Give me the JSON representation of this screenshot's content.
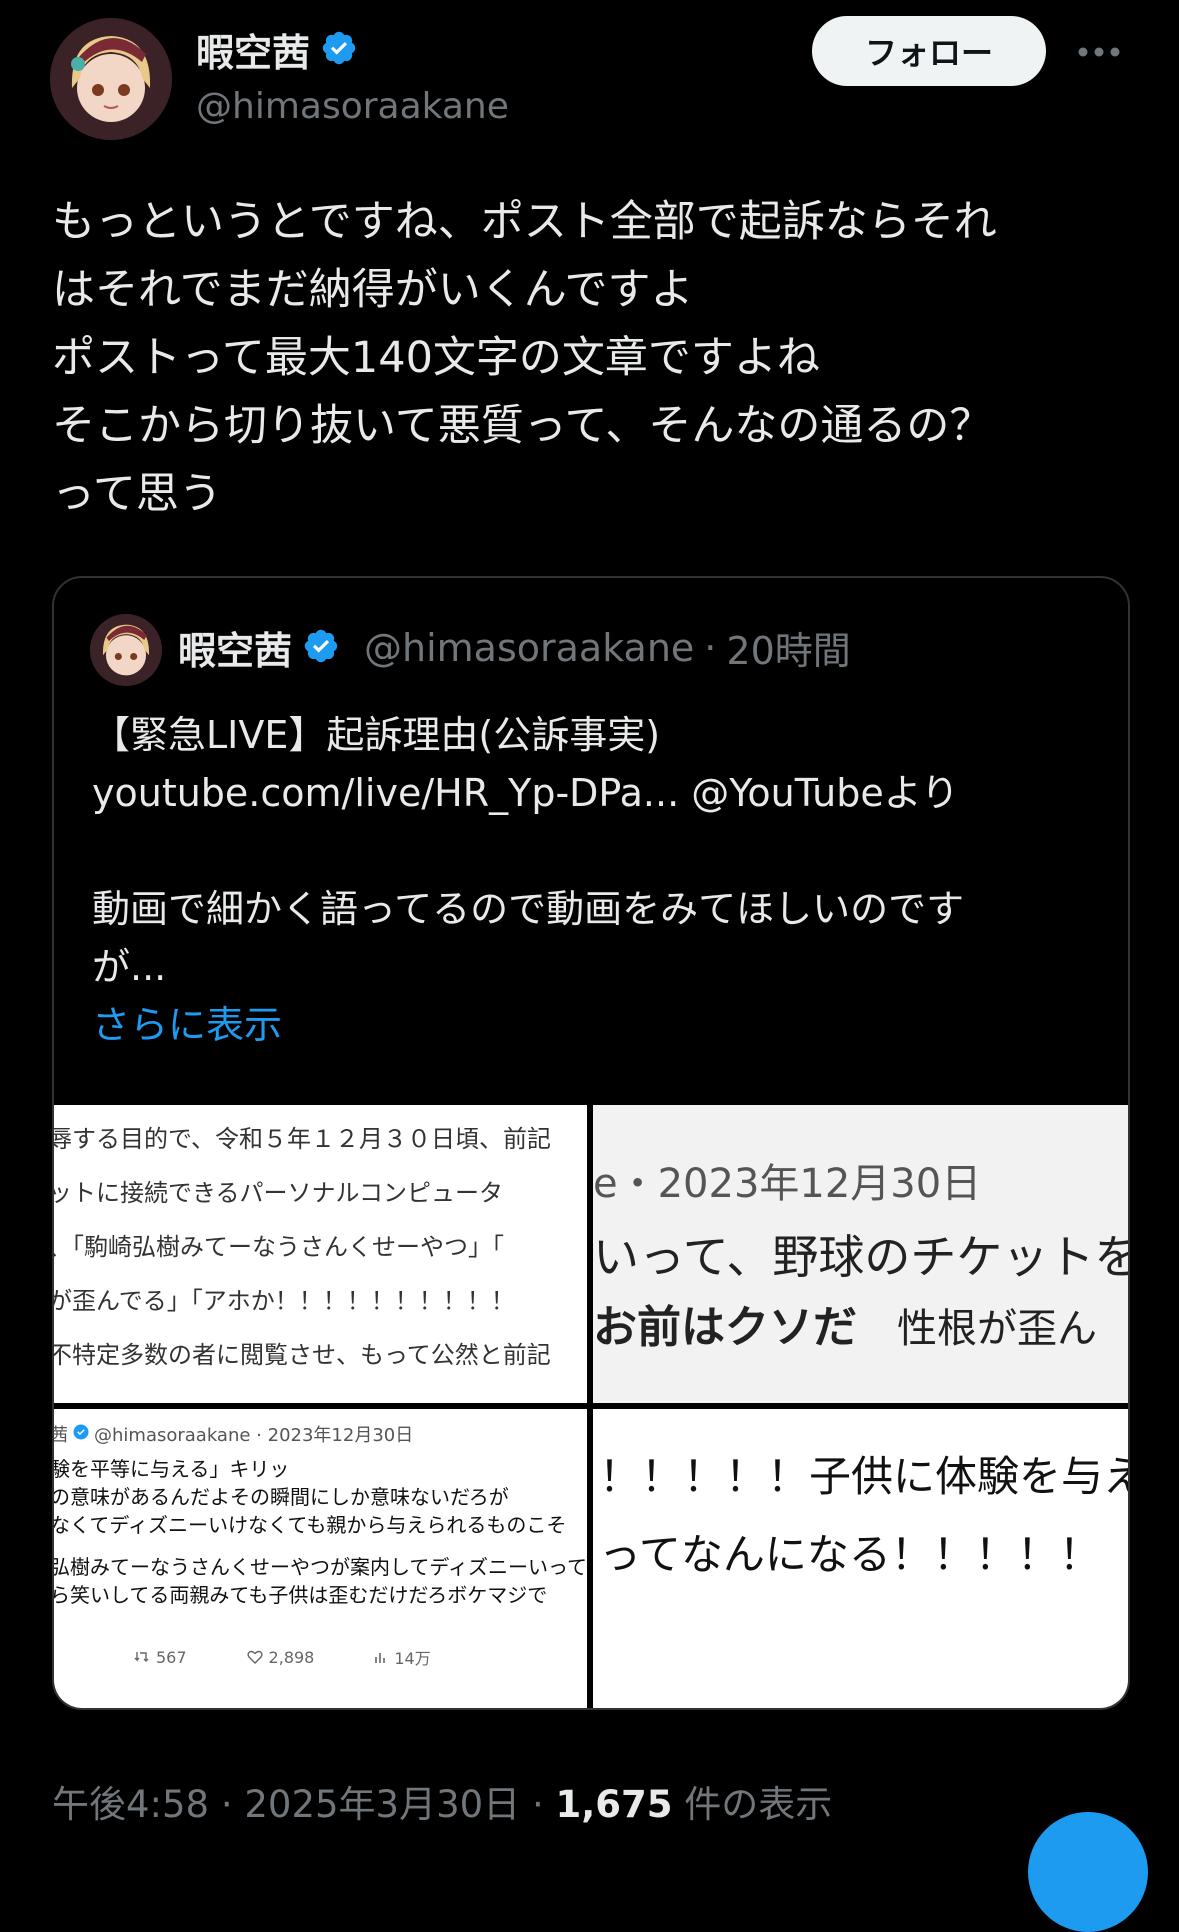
{
  "header": {
    "display_name": "暇空茜",
    "handle": "@himasoraakane",
    "follow_label": "フォロー",
    "more_icon": "more-horizontal-icon",
    "verified_icon": "verified-badge-icon",
    "verified_color": "#1d9bf0"
  },
  "post": {
    "lines": [
      "もっというとですね、ポスト全部で起訴ならそれ",
      "はそれでまだ納得がいくんですよ",
      "ポストって最大140文字の文章ですよね",
      "そこから切り抜いて悪質って、そんなの通るの？",
      "って思う"
    ]
  },
  "quote": {
    "display_name": "暇空茜",
    "handle": "@himasoraakane",
    "separator": "·",
    "time": "20時間",
    "lines": [
      "【緊急LIVE】起訴理由(公訴事実)",
      "youtube.com/live/HR_Yp-DPa... @YouTubeより",
      "",
      "動画で細かく語ってるので動画をみてほしいのです",
      "が..."
    ],
    "show_more": "さらに表示",
    "media": {
      "tile1_lines": [
        "辱する目的で、令和５年１２月３０日頃、前記",
        "ットに接続できるパーソナルコンピュータ",
        "、「駒崎弘樹みてーなうさんくせーやつ」「",
        "が歪んでる」「アホか！！！！！！！！！！",
        "不特定多数の者に閲覧させ、もって公然と前記"
      ],
      "tile2_date": "e・2023年12月30日",
      "tile2_line2": "いって、野球のチケットを",
      "tile2_line3_bold": "お前はクソだ",
      "tile2_line3_rest": "性根が歪ん",
      "tile3_header_name": "茜",
      "tile3_header_handle": "@himasoraakane · 2023年12月30日",
      "tile3_lines": [
        "験を平等に与える」キリッ",
        "の意味があるんだよその瞬間にしか意味ないだろが",
        "なくてディズニーいけなくても親から与えられるものこそ",
        "",
        "弘樹みてーなうさんくせーやつが案内してディズニーいって",
        "ら笑いしてる両親みても子供は歪むだけだろボケマジで"
      ],
      "tile3_retweets": "567",
      "tile3_likes": "2,898",
      "tile3_views": "14万",
      "tile4_line1": "！！！！！子供に体験を与え",
      "tile4_line2": "ってなんになる！！！！！"
    }
  },
  "meta": {
    "time": "午後4:58",
    "sep1": "·",
    "date": "2025年3月30日",
    "sep2": "·",
    "views_count": "1,675",
    "views_label": "件の表示"
  },
  "colors": {
    "background": "#000000",
    "text": "#e7e9ea",
    "muted": "#71767b",
    "accent": "#1d9bf0",
    "border": "#2f3336"
  }
}
